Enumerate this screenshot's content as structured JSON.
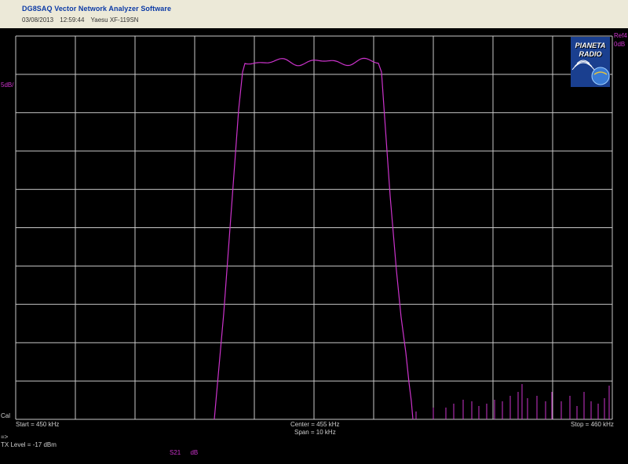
{
  "window": {
    "title": "DG8SAQ Vector Network Analyzer Software",
    "date": "03/08/2013",
    "time": "12:59:44",
    "device": "Yaesu XF-119SN"
  },
  "plot": {
    "scale": "5dB/",
    "ref_line1": "Ref4",
    "ref_line2": "0dB",
    "cal": "Cal",
    "start": "Start = 450 kHz",
    "center": "Center = 455 kHz",
    "span": "Span = 10 kHz",
    "stop": "Stop = 460 kHz",
    "arrow": "=>",
    "tx_level": "TX Level = -17 dBm",
    "trace_name": "S21",
    "trace_unit": "dB",
    "trace_color": "#cc33cc",
    "grid_color": "#c8c8c8"
  },
  "logo": {
    "line1": "PIANETA",
    "line2": "RADIO"
  }
}
